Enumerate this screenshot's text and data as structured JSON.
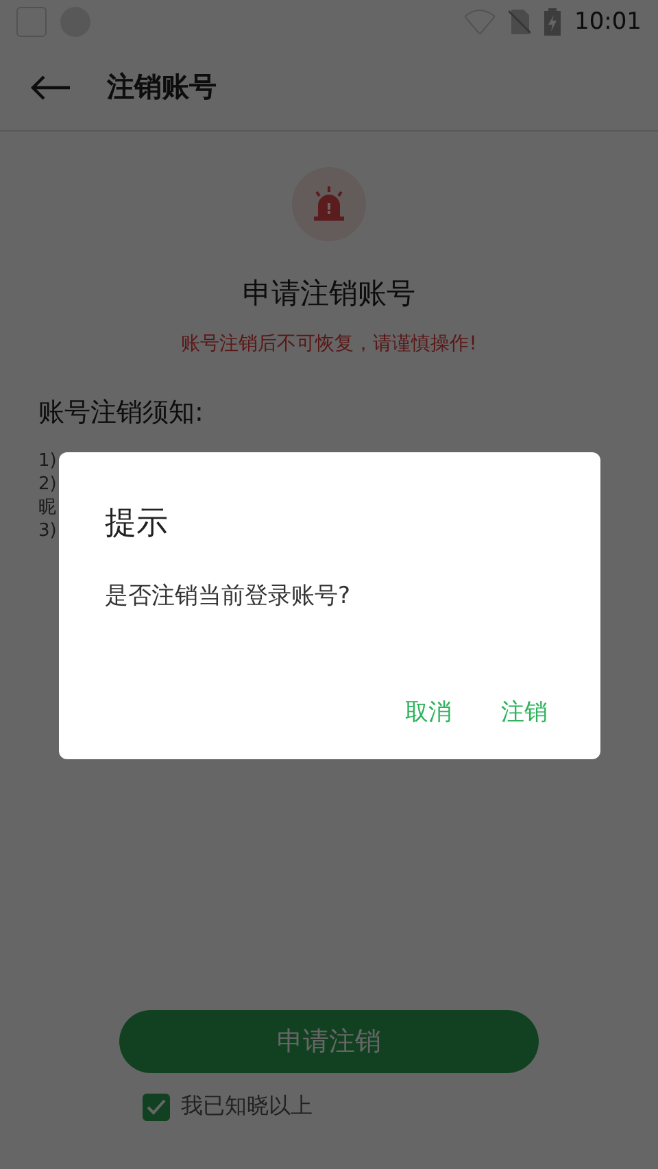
{
  "status_bar": {
    "time": "10:01"
  },
  "app_bar": {
    "title": "注销账号"
  },
  "header": {
    "title": "申请注销账号",
    "warning": "账号注销后不可恢复，请谨慎操作!"
  },
  "notice": {
    "heading": "账号注销须知:",
    "lines": [
      "1)",
      "2)",
      "昵",
      "3)"
    ]
  },
  "submit_button": {
    "label": "申请注销"
  },
  "agreement": {
    "checked": true,
    "text": "我已知晓以上"
  },
  "dialog": {
    "title": "提示",
    "message": "是否注销当前登录账号?",
    "buttons": [
      {
        "label": "取消"
      },
      {
        "label": "注销"
      }
    ]
  }
}
